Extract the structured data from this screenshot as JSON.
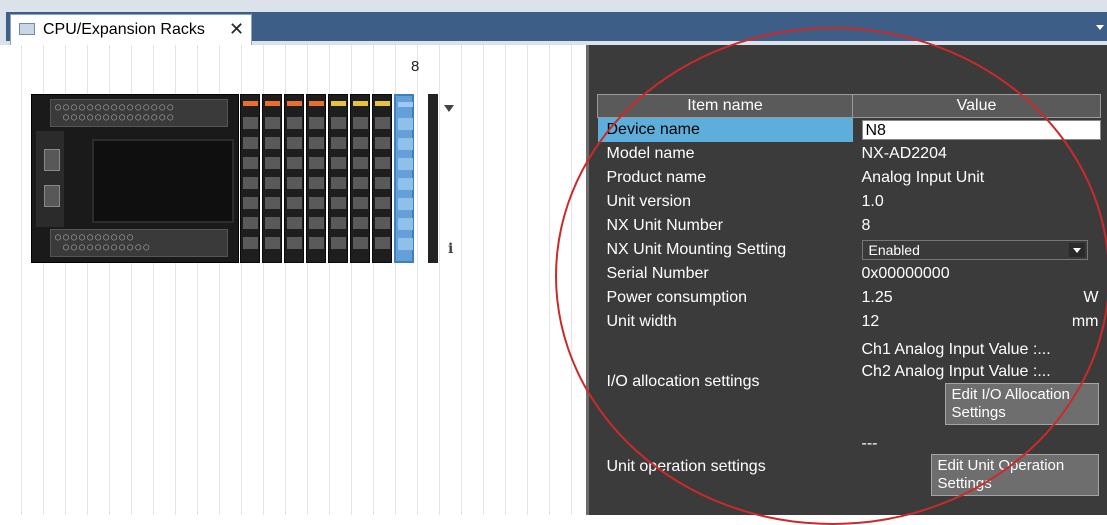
{
  "tab": {
    "title": "CPU/Expansion Racks",
    "close": "✕",
    "icon": "rack-icon"
  },
  "rack": {
    "selected_unit_number": "8",
    "info": "i",
    "unit_leds": [
      "#e8702a",
      "#e8702a",
      "#e8702a",
      "#e8702a",
      "#e8c23a",
      "#e8c23a",
      "#e8c23a",
      "#9ec8f0"
    ]
  },
  "properties": {
    "headers": {
      "item": "Item name",
      "value": "Value"
    },
    "device_name": {
      "label": "Device name",
      "value": "N8"
    },
    "model_name": {
      "label": "Model name",
      "value": "NX-AD2204"
    },
    "product_name": {
      "label": "Product name",
      "value": "Analog Input Unit"
    },
    "unit_version": {
      "label": "Unit version",
      "value": "1.0"
    },
    "nx_unit_number": {
      "label": "NX Unit Number",
      "value": "8"
    },
    "mounting": {
      "label": "NX Unit Mounting Setting",
      "value": "Enabled"
    },
    "serial_number": {
      "label": "Serial Number",
      "value": "0x00000000"
    },
    "power": {
      "label": "Power consumption",
      "value": "1.25",
      "unit": "W"
    },
    "width": {
      "label": "Unit width",
      "value": "12",
      "unit": "mm"
    },
    "io_alloc": {
      "label": "I/O allocation settings",
      "line1": "Ch1 Analog Input Value :...",
      "line2": "Ch2 Analog Input Value :...",
      "button": "Edit I/O Allocation Settings"
    },
    "unit_op": {
      "label": "Unit operation settings",
      "value": "---",
      "button": "Edit Unit Operation Settings"
    }
  }
}
